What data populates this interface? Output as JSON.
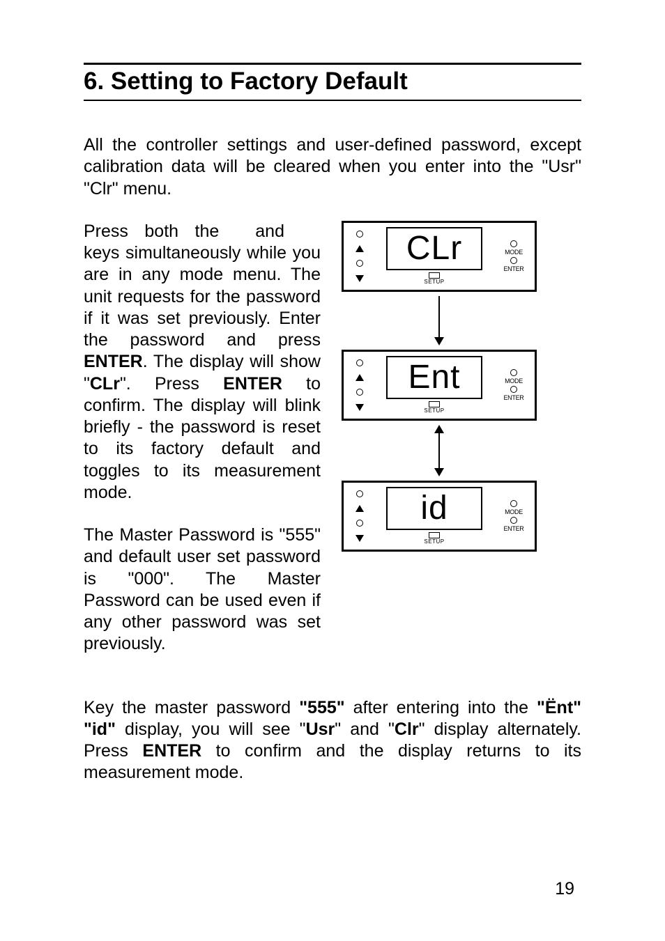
{
  "headline": "6.  Setting to Factory Default",
  "para1": "All the controller settings and user-defined password, except calibration data will be cleared when you enter into the \"Usr\" \"Clr\" menu.",
  "para2": {
    "t1": "Press both the",
    "gap_after_t1": "",
    "t2": "and",
    "gap_after_t2": "",
    "t3": "keys simultaneously while you are in any mode menu. The unit requests for the password if it was set previously. Enter the password and press ",
    "b1": "ENTER",
    "t4": ". The display will show \"",
    "b2": "CLr",
    "t5": "\". Press ",
    "b3": "ENTER",
    "t6": " to confirm. The display will blink briefly - the password is reset to its factory default and toggles to its measurement mode."
  },
  "para3": "The Master Password is \"555\" and default user set password is \"000\". The Master Password can be used even if any other password was set previously.",
  "para4": {
    "t1": "Key the master password ",
    "b1": "\"555\"",
    "t2": " after entering into the ",
    "b2": "\"Ënt\" \"id\"",
    "t3": " display, you will see \"",
    "b3": "Usr",
    "t4": "\" and \"",
    "b4": "Clr",
    "t5": "\" display alternately. Press ",
    "b5": "ENTER",
    "t6": " to confirm and the display returns to its measurement mode."
  },
  "diagram": {
    "box1": "CLr",
    "box2": "Ent",
    "box3": "id",
    "setup": "SETUP",
    "mode": "MODE",
    "enter": "ENTER"
  },
  "page_number": "19"
}
